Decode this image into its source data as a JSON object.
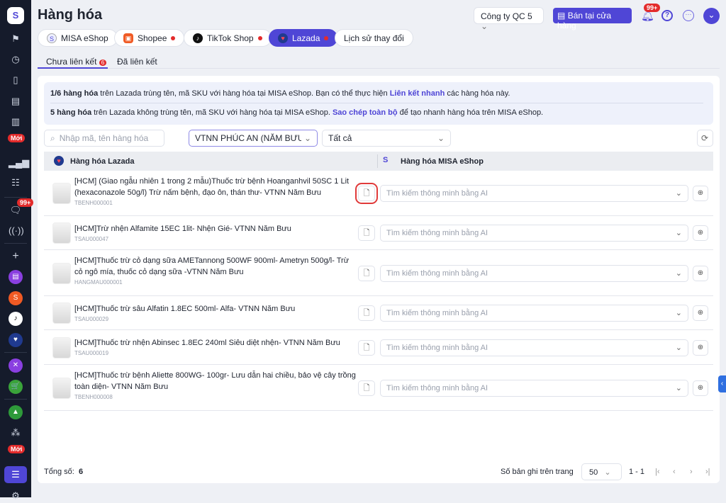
{
  "sidebar": {
    "new_badge": "Mới",
    "chat_badge": "99+",
    "new_badge2": "Mới"
  },
  "header": {
    "title": "Hàng hóa",
    "company": "Công ty QC 5",
    "pos_button": "Bán tại cửa hàng",
    "notif_badge": "99+"
  },
  "channels": [
    {
      "label": "MISA eShop"
    },
    {
      "label": "Shopee",
      "dot": true
    },
    {
      "label": "TikTok Shop",
      "dot": true
    },
    {
      "label": "Lazada",
      "dot": true,
      "active": true
    },
    {
      "label": "Lịch sử thay đổi"
    }
  ],
  "subtabs": {
    "unlinked": "Chưa liên kết",
    "unlinked_count": "6",
    "linked": "Đã liên kết"
  },
  "info": {
    "line1_bold": "1/6 hàng hóa",
    "line1_text": " trên Lazada trùng tên, mã SKU với hàng hóa tại MISA eShop. Bạn có thể thực hiện ",
    "line1_link": "Liên kết nhanh",
    "line1_end": " các hàng hóa này.",
    "line2_bold": "5 hàng hóa",
    "line2_text": " trên Lazada không trùng tên, mã SKU với hàng hóa tại MISA eShop. ",
    "line2_link": "Sao chép toàn bộ",
    "line2_end": " để tạo nhanh hàng hóa trên MISA eShop."
  },
  "filters": {
    "search_placeholder": "Nhập mã, tên hàng hóa",
    "store": "VTNN PHÚC AN (NĂM BƯU) H",
    "status": "Tất cả"
  },
  "table": {
    "col_left": "Hàng hóa Lazada",
    "col_right": "Hàng hóa MISA eShop",
    "search_placeholder": "Tìm kiếm thông minh bằng AI",
    "rows": [
      {
        "name": "[HCM] (Giao ngẫu nhiên 1 trong 2 mẫu)Thuốc trừ bệnh Hoanganhvil 50SC 1 Lit (hexaconazole 50g/l) Trừ nấm bệnh, đạo ôn, thán thư- VTNN Năm Bưu",
        "sku": "TBENH000001"
      },
      {
        "name": "[HCM]Trừ nhện Alfamite 15EC 1lit- Nhện Gié- VTNN Năm Bưu",
        "sku": "TSAU000047"
      },
      {
        "name": "[HCM]Thuốc trừ cỏ dạng sữa AMETannong 500WF 900ml- Ametryn 500g/l- Trừ cỏ ngô mía, thuốc cỏ dạng sữa -VTNN Năm Bưu",
        "sku": "HANGMAU000001"
      },
      {
        "name": "[HCM]Thuốc trừ sâu Alfatin 1.8EC 500ml- Alfa- VTNN Năm Bưu",
        "sku": "TSAU000029"
      },
      {
        "name": "[HCM]Thuốc trừ nhện Abinsec 1.8EC 240ml Siêu diệt nhện- VTNN Năm Bưu",
        "sku": "TSAU000019"
      },
      {
        "name": "[HCM]Thuốc trừ bệnh Aliette 800WG- 100gr- Lưu dẫn hai chiều, bảo vệ cây trồng toàn diện- VTNN Năm Bưu",
        "sku": "TBENH000008"
      }
    ]
  },
  "footer": {
    "total_label": "Tổng số:",
    "total": "6",
    "per_page_label": "Số bản ghi trên trang",
    "per_page": "50",
    "range": "1 - 1"
  },
  "colors": {
    "accent": "#4f46d6",
    "sidebar": "#151b2b",
    "badge": "#e32b2b"
  }
}
